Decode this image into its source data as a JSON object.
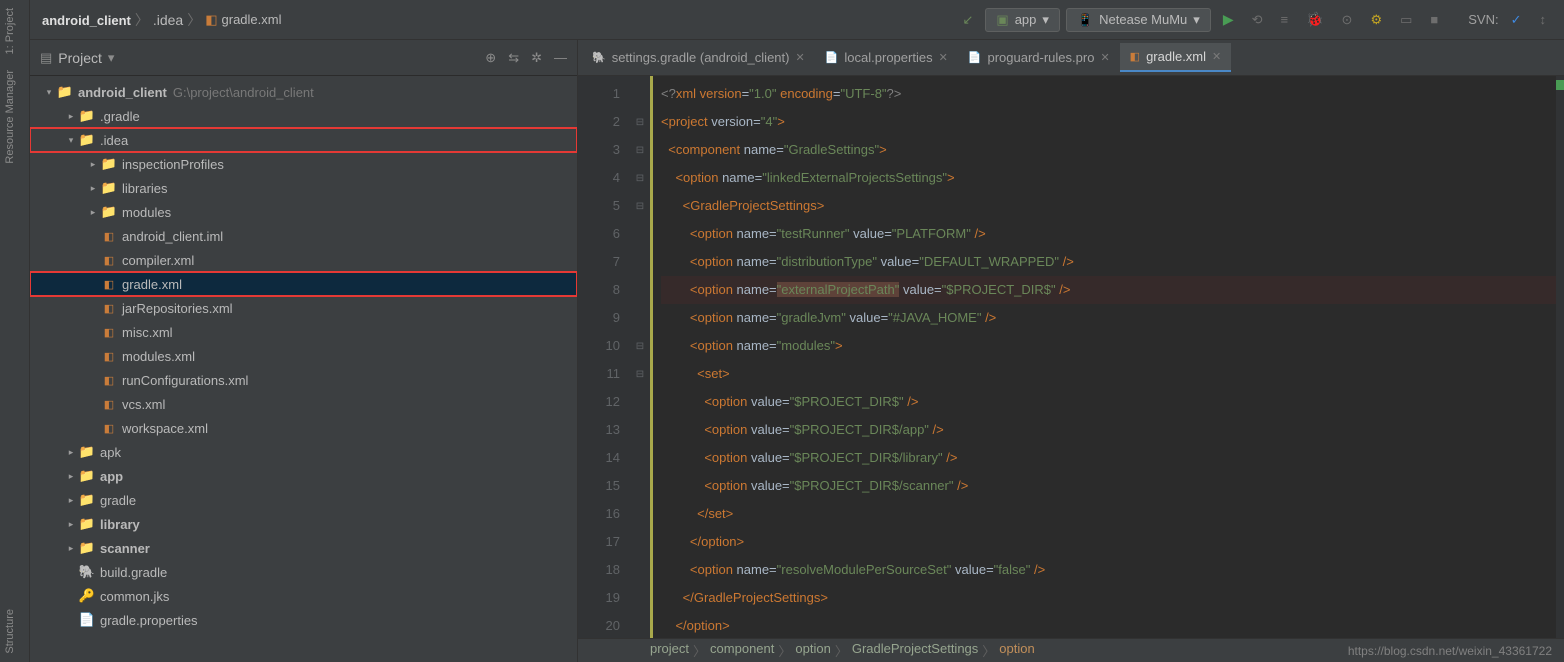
{
  "breadcrumb": [
    "android_client",
    ".idea",
    "gradle.xml"
  ],
  "run_config": "app",
  "device": "Netease MuMu",
  "svn_label": "SVN:",
  "panel": {
    "title": "Project"
  },
  "left_rail": {
    "project": "1: Project",
    "res_mgr": "Resource Manager",
    "structure": "Structure"
  },
  "tree": {
    "root": {
      "name": "android_client",
      "hint": "G:\\project\\android_client"
    },
    "gradle_dir": ".gradle",
    "idea_dir": ".idea",
    "idea_children": [
      "inspectionProfiles",
      "libraries",
      "modules",
      "android_client.iml",
      "compiler.xml",
      "gradle.xml",
      "jarRepositories.xml",
      "misc.xml",
      "modules.xml",
      "runConfigurations.xml",
      "vcs.xml",
      "workspace.xml"
    ],
    "rest": [
      "apk",
      "app",
      "gradle",
      "library",
      "scanner",
      "build.gradle",
      "common.jks",
      "gradle.properties"
    ]
  },
  "tabs": [
    {
      "label": "settings.gradle (android_client)",
      "active": false
    },
    {
      "label": "local.properties",
      "active": false
    },
    {
      "label": "proguard-rules.pro",
      "active": false
    },
    {
      "label": "gradle.xml",
      "active": true
    }
  ],
  "editor": {
    "lines": [
      {
        "n": 1,
        "html": "<span class='t-pi'>&lt;?</span><span class='t-tag'>xml version</span><span class='t-attr'>=</span><span class='t-str'>\"1.0\"</span> <span class='t-tag'>encoding</span><span class='t-attr'>=</span><span class='t-str'>\"UTF-8\"</span><span class='t-pi'>?&gt;</span>"
      },
      {
        "n": 2,
        "html": "<span class='t-tag'>&lt;project </span><span class='t-attr'>version=</span><span class='t-str'>\"4\"</span><span class='t-tag'>&gt;</span>"
      },
      {
        "n": 3,
        "html": "  <span class='t-tag'>&lt;component </span><span class='t-attr'>name=</span><span class='t-str'>\"GradleSettings\"</span><span class='t-tag'>&gt;</span>"
      },
      {
        "n": 4,
        "html": "    <span class='t-tag'>&lt;option </span><span class='t-attr'>name=</span><span class='t-str'>\"linkedExternalProjectsSettings\"</span><span class='t-tag'>&gt;</span>"
      },
      {
        "n": 5,
        "html": "      <span class='t-tag'>&lt;GradleProjectSettings&gt;</span>"
      },
      {
        "n": 6,
        "html": "        <span class='t-tag'>&lt;option </span><span class='t-attr'>name=</span><span class='t-str'>\"testRunner\"</span> <span class='t-attr'>value=</span><span class='t-str'>\"PLATFORM\"</span> <span class='t-tag'>/&gt;</span>"
      },
      {
        "n": 7,
        "html": "        <span class='t-tag'>&lt;option </span><span class='t-attr'>name=</span><span class='t-str'>\"distributionType\"</span> <span class='t-attr'>value=</span><span class='t-str'>\"DEFAULT_WRAPPED\"</span> <span class='t-tag'>/&gt;</span>"
      },
      {
        "n": 8,
        "cls": "err",
        "html": "        <span class='t-tag'>&lt;option </span><span class='t-attr'>name=</span><span class='t-str' style='background:#5e4239'>\"externalProjectPath\"</span> <span class='t-attr'>value=</span><span class='t-str'>\"$PROJECT_DIR$\"</span> <span class='t-tag'>/&gt;</span>"
      },
      {
        "n": 9,
        "html": "        <span class='t-tag'>&lt;option </span><span class='t-attr'>name=</span><span class='t-str'>\"gradleJvm\"</span> <span class='t-attr'>value=</span><span class='t-str'>\"#JAVA_HOME\"</span> <span class='t-tag'>/&gt;</span>"
      },
      {
        "n": 10,
        "html": "        <span class='t-tag'>&lt;option </span><span class='t-attr'>name=</span><span class='t-str'>\"modules\"</span><span class='t-tag'>&gt;</span>"
      },
      {
        "n": 11,
        "html": "          <span class='t-tag'>&lt;set&gt;</span>"
      },
      {
        "n": 12,
        "html": "            <span class='t-tag'>&lt;option </span><span class='t-attr'>value=</span><span class='t-str'>\"$PROJECT_DIR$\"</span> <span class='t-tag'>/&gt;</span>"
      },
      {
        "n": 13,
        "html": "            <span class='t-tag'>&lt;option </span><span class='t-attr'>value=</span><span class='t-str'>\"$PROJECT_DIR$/app\"</span> <span class='t-tag'>/&gt;</span>"
      },
      {
        "n": 14,
        "html": "            <span class='t-tag'>&lt;option </span><span class='t-attr'>value=</span><span class='t-str'>\"$PROJECT_DIR$/library\"</span> <span class='t-tag'>/&gt;</span>"
      },
      {
        "n": 15,
        "html": "            <span class='t-tag'>&lt;option </span><span class='t-attr'>value=</span><span class='t-str'>\"$PROJECT_DIR$/scanner\"</span> <span class='t-tag'>/&gt;</span>"
      },
      {
        "n": 16,
        "html": "          <span class='t-tag'>&lt;/set&gt;</span>"
      },
      {
        "n": 17,
        "html": "        <span class='t-tag'>&lt;/option&gt;</span>"
      },
      {
        "n": 18,
        "html": "        <span class='t-tag'>&lt;option </span><span class='t-attr'>name=</span><span class='t-str'>\"resolveModulePerSourceSet\"</span> <span class='t-attr'>value=</span><span class='t-str'>\"false\"</span> <span class='t-tag'>/&gt;</span>"
      },
      {
        "n": 19,
        "html": "      <span class='t-tag'>&lt;/GradleProjectSettings&gt;</span>"
      },
      {
        "n": 20,
        "html": "    <span class='t-tag'>&lt;/option&gt;</span>"
      }
    ]
  },
  "status_path": [
    "project",
    "component",
    "option",
    "GradleProjectSettings",
    "option"
  ],
  "watermark": "https://blog.csdn.net/weixin_43361722",
  "chart_data": {
    "type": "table",
    "note": "XML file content shown in editor",
    "file": "gradle.xml",
    "xml": {
      "project": {
        "version": "4"
      },
      "component": {
        "name": "GradleSettings"
      },
      "linkedExternalProjectsSettings": {
        "GradleProjectSettings": {
          "testRunner": "PLATFORM",
          "distributionType": "DEFAULT_WRAPPED",
          "externalProjectPath": "$PROJECT_DIR$",
          "gradleJvm": "#JAVA_HOME",
          "modules": [
            "$PROJECT_DIR$",
            "$PROJECT_DIR$/app",
            "$PROJECT_DIR$/library",
            "$PROJECT_DIR$/scanner"
          ],
          "resolveModulePerSourceSet": "false"
        }
      }
    }
  }
}
